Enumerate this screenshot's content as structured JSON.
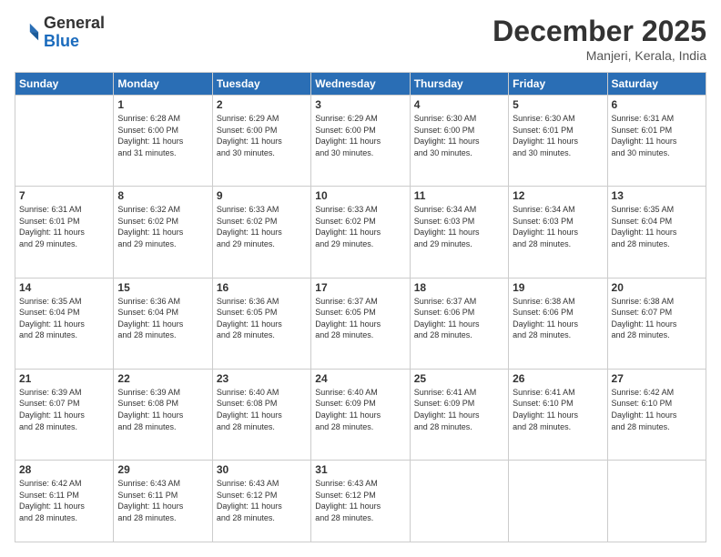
{
  "header": {
    "logo_line1": "General",
    "logo_line2": "Blue",
    "title": "December 2025",
    "location": "Manjeri, Kerala, India"
  },
  "days_of_week": [
    "Sunday",
    "Monday",
    "Tuesday",
    "Wednesday",
    "Thursday",
    "Friday",
    "Saturday"
  ],
  "weeks": [
    [
      {
        "num": "",
        "info": ""
      },
      {
        "num": "1",
        "info": "Sunrise: 6:28 AM\nSunset: 6:00 PM\nDaylight: 11 hours\nand 31 minutes."
      },
      {
        "num": "2",
        "info": "Sunrise: 6:29 AM\nSunset: 6:00 PM\nDaylight: 11 hours\nand 30 minutes."
      },
      {
        "num": "3",
        "info": "Sunrise: 6:29 AM\nSunset: 6:00 PM\nDaylight: 11 hours\nand 30 minutes."
      },
      {
        "num": "4",
        "info": "Sunrise: 6:30 AM\nSunset: 6:00 PM\nDaylight: 11 hours\nand 30 minutes."
      },
      {
        "num": "5",
        "info": "Sunrise: 6:30 AM\nSunset: 6:01 PM\nDaylight: 11 hours\nand 30 minutes."
      },
      {
        "num": "6",
        "info": "Sunrise: 6:31 AM\nSunset: 6:01 PM\nDaylight: 11 hours\nand 30 minutes."
      }
    ],
    [
      {
        "num": "7",
        "info": "Sunrise: 6:31 AM\nSunset: 6:01 PM\nDaylight: 11 hours\nand 29 minutes."
      },
      {
        "num": "8",
        "info": "Sunrise: 6:32 AM\nSunset: 6:02 PM\nDaylight: 11 hours\nand 29 minutes."
      },
      {
        "num": "9",
        "info": "Sunrise: 6:33 AM\nSunset: 6:02 PM\nDaylight: 11 hours\nand 29 minutes."
      },
      {
        "num": "10",
        "info": "Sunrise: 6:33 AM\nSunset: 6:02 PM\nDaylight: 11 hours\nand 29 minutes."
      },
      {
        "num": "11",
        "info": "Sunrise: 6:34 AM\nSunset: 6:03 PM\nDaylight: 11 hours\nand 29 minutes."
      },
      {
        "num": "12",
        "info": "Sunrise: 6:34 AM\nSunset: 6:03 PM\nDaylight: 11 hours\nand 28 minutes."
      },
      {
        "num": "13",
        "info": "Sunrise: 6:35 AM\nSunset: 6:04 PM\nDaylight: 11 hours\nand 28 minutes."
      }
    ],
    [
      {
        "num": "14",
        "info": "Sunrise: 6:35 AM\nSunset: 6:04 PM\nDaylight: 11 hours\nand 28 minutes."
      },
      {
        "num": "15",
        "info": "Sunrise: 6:36 AM\nSunset: 6:04 PM\nDaylight: 11 hours\nand 28 minutes."
      },
      {
        "num": "16",
        "info": "Sunrise: 6:36 AM\nSunset: 6:05 PM\nDaylight: 11 hours\nand 28 minutes."
      },
      {
        "num": "17",
        "info": "Sunrise: 6:37 AM\nSunset: 6:05 PM\nDaylight: 11 hours\nand 28 minutes."
      },
      {
        "num": "18",
        "info": "Sunrise: 6:37 AM\nSunset: 6:06 PM\nDaylight: 11 hours\nand 28 minutes."
      },
      {
        "num": "19",
        "info": "Sunrise: 6:38 AM\nSunset: 6:06 PM\nDaylight: 11 hours\nand 28 minutes."
      },
      {
        "num": "20",
        "info": "Sunrise: 6:38 AM\nSunset: 6:07 PM\nDaylight: 11 hours\nand 28 minutes."
      }
    ],
    [
      {
        "num": "21",
        "info": "Sunrise: 6:39 AM\nSunset: 6:07 PM\nDaylight: 11 hours\nand 28 minutes."
      },
      {
        "num": "22",
        "info": "Sunrise: 6:39 AM\nSunset: 6:08 PM\nDaylight: 11 hours\nand 28 minutes."
      },
      {
        "num": "23",
        "info": "Sunrise: 6:40 AM\nSunset: 6:08 PM\nDaylight: 11 hours\nand 28 minutes."
      },
      {
        "num": "24",
        "info": "Sunrise: 6:40 AM\nSunset: 6:09 PM\nDaylight: 11 hours\nand 28 minutes."
      },
      {
        "num": "25",
        "info": "Sunrise: 6:41 AM\nSunset: 6:09 PM\nDaylight: 11 hours\nand 28 minutes."
      },
      {
        "num": "26",
        "info": "Sunrise: 6:41 AM\nSunset: 6:10 PM\nDaylight: 11 hours\nand 28 minutes."
      },
      {
        "num": "27",
        "info": "Sunrise: 6:42 AM\nSunset: 6:10 PM\nDaylight: 11 hours\nand 28 minutes."
      }
    ],
    [
      {
        "num": "28",
        "info": "Sunrise: 6:42 AM\nSunset: 6:11 PM\nDaylight: 11 hours\nand 28 minutes."
      },
      {
        "num": "29",
        "info": "Sunrise: 6:43 AM\nSunset: 6:11 PM\nDaylight: 11 hours\nand 28 minutes."
      },
      {
        "num": "30",
        "info": "Sunrise: 6:43 AM\nSunset: 6:12 PM\nDaylight: 11 hours\nand 28 minutes."
      },
      {
        "num": "31",
        "info": "Sunrise: 6:43 AM\nSunset: 6:12 PM\nDaylight: 11 hours\nand 28 minutes."
      },
      {
        "num": "",
        "info": ""
      },
      {
        "num": "",
        "info": ""
      },
      {
        "num": "",
        "info": ""
      }
    ]
  ]
}
